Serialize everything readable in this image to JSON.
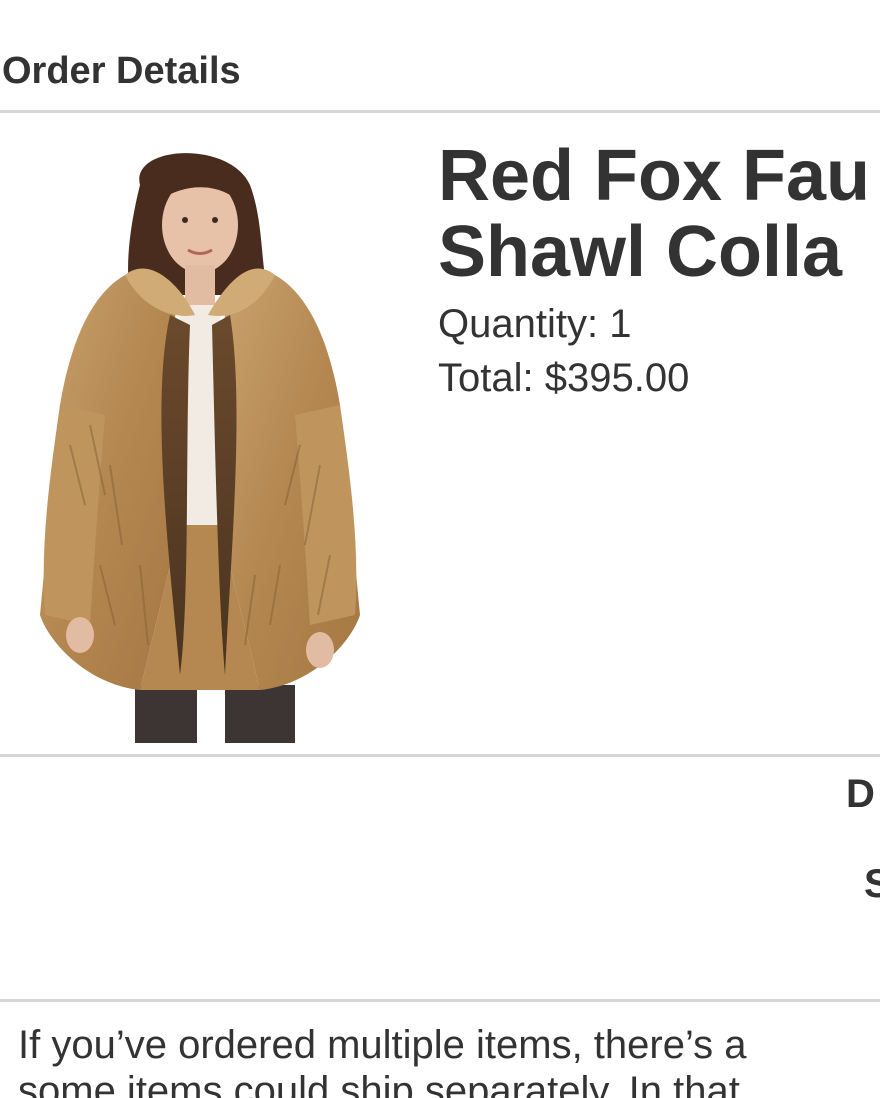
{
  "header": {
    "title": "Order Details"
  },
  "product": {
    "name_line1": "Red Fox Fau",
    "name_line2": "Shawl Colla",
    "quantity": "Quantity: 1",
    "total": "Total: $395.00",
    "image_icon": "fur-coat-model-photo"
  },
  "summary": {
    "label_1": "D",
    "label_2": "S"
  },
  "notice": {
    "line1": "If you’ve ordered multiple items, there’s a",
    "line2": "some items could ship separately. In that"
  },
  "colors": {
    "text": "#333333",
    "divider": "#d6d6d6",
    "background": "#ffffff"
  }
}
